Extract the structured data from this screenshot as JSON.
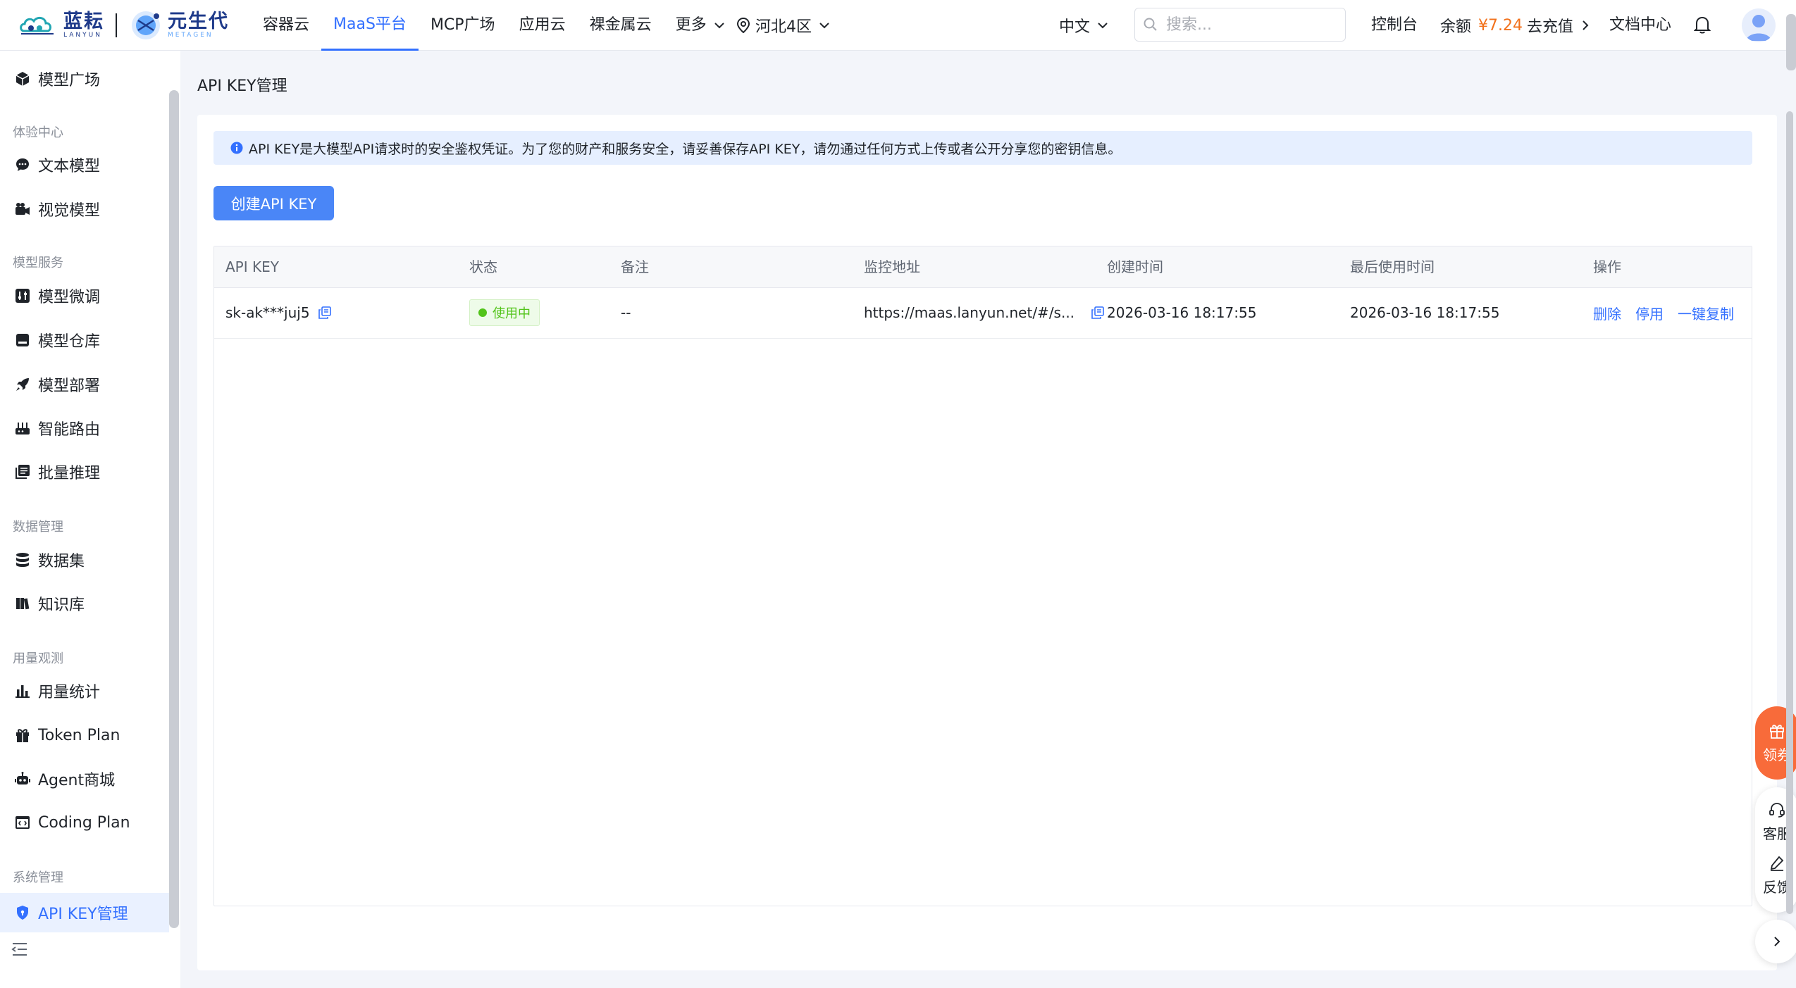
{
  "brand": {
    "name_zh": "蓝耘",
    "name_en": "LANYUN",
    "partner_zh": "元生代",
    "partner_en": "METAGEN"
  },
  "nav": {
    "items": [
      {
        "label": "容器云",
        "active": false
      },
      {
        "label": "MaaS平台",
        "active": true
      },
      {
        "label": "MCP广场",
        "active": false
      },
      {
        "label": "应用云",
        "active": false
      },
      {
        "label": "裸金属云",
        "active": false
      },
      {
        "label": "更多",
        "active": false
      }
    ],
    "region": "河北4区"
  },
  "header": {
    "language": "中文",
    "search_placeholder": "搜索...",
    "console": "控制台",
    "balance_label": "余额",
    "balance_amount": "¥7.24",
    "recharge": "去充值",
    "docs": "文档中心"
  },
  "sidebar": {
    "top_item": {
      "label": "模型广场",
      "icon": "cube-icon"
    },
    "groups": [
      {
        "title": "体验中心",
        "items": [
          {
            "label": "文本模型",
            "icon": "chat-icon"
          },
          {
            "label": "视觉模型",
            "icon": "video-camera-icon"
          }
        ]
      },
      {
        "title": "模型服务",
        "items": [
          {
            "label": "模型微调",
            "icon": "sliders-icon"
          },
          {
            "label": "模型仓库",
            "icon": "archive-icon"
          },
          {
            "label": "模型部署",
            "icon": "rocket-icon"
          },
          {
            "label": "智能路由",
            "icon": "router-icon"
          },
          {
            "label": "批量推理",
            "icon": "stack-icon"
          }
        ]
      },
      {
        "title": "数据管理",
        "items": [
          {
            "label": "数据集",
            "icon": "database-icon"
          },
          {
            "label": "知识库",
            "icon": "book-icon"
          }
        ]
      },
      {
        "title": "用量观测",
        "items": [
          {
            "label": "用量统计",
            "icon": "bar-chart-icon"
          },
          {
            "label": "Token Plan",
            "icon": "gift-icon"
          },
          {
            "label": "Agent商城",
            "icon": "robot-icon"
          },
          {
            "label": "Coding Plan",
            "icon": "code-window-icon"
          }
        ]
      },
      {
        "title": "系统管理",
        "items": [
          {
            "label": "API KEY管理",
            "icon": "shield-icon",
            "active": true
          }
        ]
      }
    ]
  },
  "page": {
    "title": "API KEY管理",
    "notice": "API KEY是大模型API请求时的安全鉴权凭证。为了您的财产和服务安全，请妥善保存API KEY，请勿通过任何方式上传或者公开分享您的密钥信息。",
    "create_button": "创建API KEY"
  },
  "table": {
    "columns": [
      "API KEY",
      "状态",
      "备注",
      "监控地址",
      "创建时间",
      "最后使用时间",
      "操作"
    ],
    "rows": [
      {
        "api_key": "sk-ak***juj5",
        "status": "使用中",
        "remark": "--",
        "monitor_url": "https://maas.lanyun.net/#/s...",
        "created_at": "2026-03-16 18:17:55",
        "last_used_at": "2026-03-16 18:17:55",
        "actions": [
          "删除",
          "停用",
          "一键复制"
        ]
      }
    ]
  },
  "float": {
    "coupon": "领券",
    "service": "客服",
    "feedback": "反馈"
  },
  "colors": {
    "primary": "#3370ff",
    "button": "#4a86f7",
    "coupon": "#f86b3a",
    "success": "#52c41a",
    "price": "#f2711c"
  }
}
